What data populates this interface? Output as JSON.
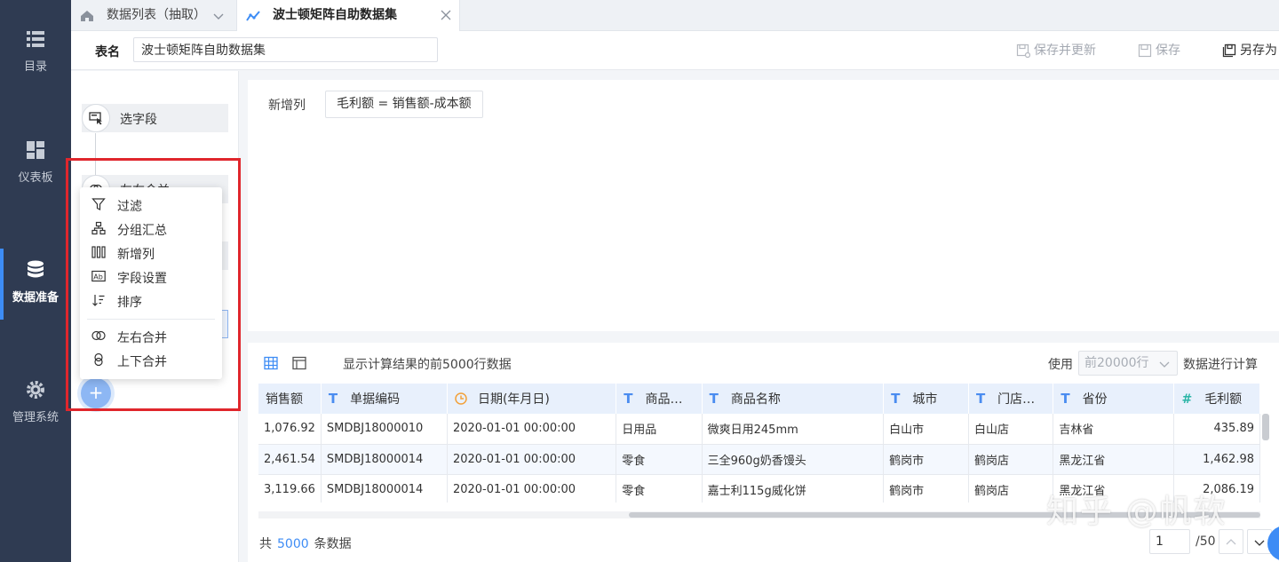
{
  "nav": {
    "items": [
      {
        "label": "目录",
        "icon": "list-icon"
      },
      {
        "label": "仪表板",
        "icon": "dashboard-icon"
      },
      {
        "label": "数据准备",
        "icon": "database-icon",
        "active": true
      },
      {
        "label": "管理系统",
        "icon": "gear-icon"
      }
    ]
  },
  "tabs": [
    {
      "label": "数据列表（抽取）",
      "icon": "home-icon"
    },
    {
      "label": "波士顿矩阵自助数据集",
      "icon": "chart-line-icon"
    }
  ],
  "header": {
    "table_name_label": "表名",
    "table_name_value": "波士顿矩阵自助数据集",
    "save_update_label": "保存并更新",
    "save_label": "保存",
    "save_as_label": "另存为"
  },
  "flow": {
    "nodes": [
      "选字段",
      "左右合并"
    ]
  },
  "menu": {
    "items": [
      {
        "label": "过滤",
        "icon": "filter-icon"
      },
      {
        "label": "分组汇总",
        "icon": "group-icon"
      },
      {
        "label": "新增列",
        "icon": "columns-icon"
      },
      {
        "label": "字段设置",
        "icon": "ab-icon"
      },
      {
        "label": "排序",
        "icon": "sort-icon"
      },
      {
        "label": "左右合并",
        "icon": "join-lr-icon"
      },
      {
        "label": "上下合并",
        "icon": "join-ud-icon"
      }
    ]
  },
  "main": {
    "new_col_label": "新增列",
    "formula": "毛利额 = 销售额-成本额"
  },
  "preview": {
    "desc": "显示计算结果的前5000行数据",
    "use_label": "使用",
    "rows_select": "前20000行",
    "calc_label": "数据进行计算",
    "columns": [
      {
        "label": "销售额",
        "type": "none"
      },
      {
        "label": "单据编码",
        "type": "T"
      },
      {
        "label": "日期(年月日)",
        "type": "date"
      },
      {
        "label": "商品…",
        "type": "T"
      },
      {
        "label": "商品名称",
        "type": "T"
      },
      {
        "label": "城市",
        "type": "T"
      },
      {
        "label": "门店…",
        "type": "T"
      },
      {
        "label": "省份",
        "type": "T"
      },
      {
        "label": "毛利额",
        "type": "#"
      }
    ],
    "rows": [
      [
        "1,076.92",
        "SMDBJ18000010",
        "2020-01-01 00:00:00",
        "日用品",
        "微爽日用245mm",
        "白山市",
        "白山店",
        "吉林省",
        "435.89"
      ],
      [
        "2,461.54",
        "SMDBJ18000014",
        "2020-01-01 00:00:00",
        "零食",
        "三全960g奶香馒头",
        "鹤岗市",
        "鹤岗店",
        "黑龙江省",
        "1,462.98"
      ],
      [
        "3,119.66",
        "SMDBJ18000014",
        "2020-01-01 00:00:00",
        "零食",
        "嘉士利115g威化饼",
        "鹤岗市",
        "鹤岗店",
        "黑龙江省",
        "2,086.19"
      ]
    ],
    "total_prefix": "共",
    "total_count": "5000",
    "total_suffix": "条数据",
    "page_current": "1",
    "page_total": "/50"
  },
  "watermark": "知乎 @帆软"
}
